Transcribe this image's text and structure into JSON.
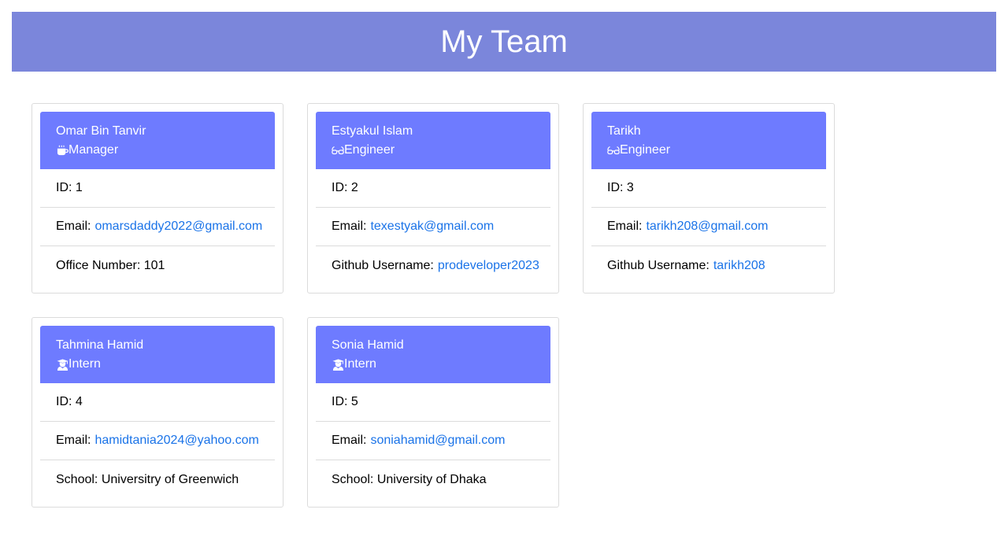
{
  "header": {
    "title": "My Team"
  },
  "labels": {
    "id": "ID:",
    "email": "Email:",
    "office": "Office Number:",
    "github": "Github Username:",
    "school": "School:"
  },
  "colors": {
    "header_bg": "#7b86db",
    "card_head_bg": "#6e7bff",
    "link": "#1a73e8"
  },
  "employees": [
    {
      "name": "Omar Bin Tanvir",
      "role": "Manager",
      "icon": "coffee-mug-icon",
      "id": "1",
      "email": "omarsdaddy2022@gmail.com",
      "office": "101"
    },
    {
      "name": "Estyakul Islam",
      "role": "Engineer",
      "icon": "glasses-icon",
      "id": "2",
      "email": "texestyak@gmail.com",
      "github": "prodeveloper2023"
    },
    {
      "name": "Tarikh",
      "role": "Engineer",
      "icon": "glasses-icon",
      "id": "3",
      "email": "tarikh208@gmail.com",
      "github": "tarikh208"
    },
    {
      "name": "Tahmina Hamid",
      "role": "Intern",
      "icon": "graduate-icon",
      "id": "4",
      "email": "hamidtania2024@yahoo.com",
      "school": "Universitry of Greenwich"
    },
    {
      "name": "Sonia Hamid",
      "role": "Intern",
      "icon": "graduate-icon",
      "id": "5",
      "email": "soniahamid@gmail.com",
      "school": "University of Dhaka"
    }
  ]
}
